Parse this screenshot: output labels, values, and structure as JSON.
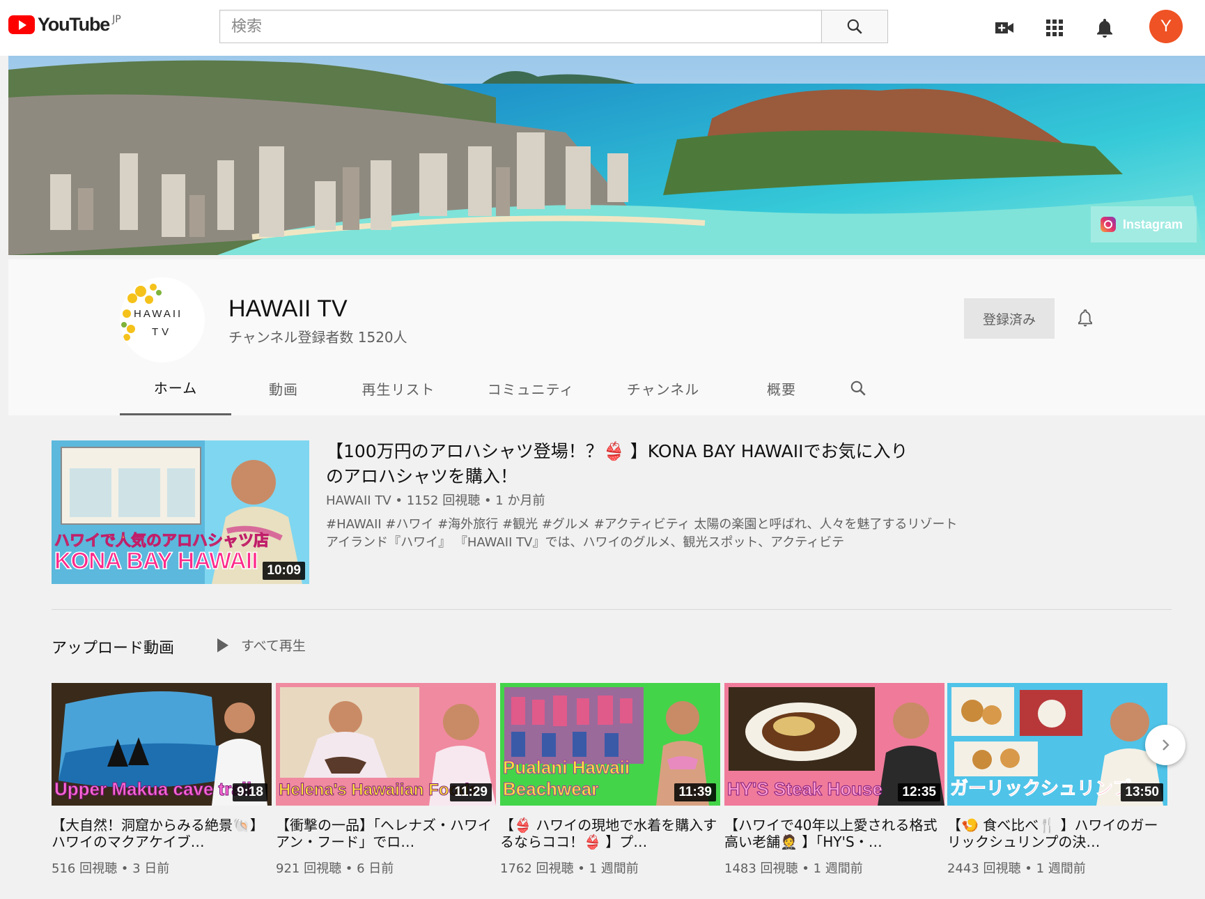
{
  "header": {
    "logo_text": "YouTube",
    "logo_region": "JP",
    "search_placeholder": "検索",
    "avatar_letter": "Y"
  },
  "banner": {
    "link_label": "Instagram"
  },
  "channel": {
    "avatar_line1": "HAWAII",
    "avatar_line2": "TV",
    "name": "HAWAII TV",
    "subscribers": "チャンネル登録者数 1520人",
    "subscribe_label": "登録済み",
    "tabs": [
      {
        "label": "ホーム",
        "active": true
      },
      {
        "label": "動画"
      },
      {
        "label": "再生リスト"
      },
      {
        "label": "コミュニティ"
      },
      {
        "label": "チャンネル"
      },
      {
        "label": "概要"
      }
    ]
  },
  "featured": {
    "title": "【100万円のアロハシャツ登場！？👙 】KONA BAY HAWAIIでお気に入りのアロハシャツを購入！",
    "meta": "HAWAII TV • 1152 回視聴 • 1 か月前",
    "description": "#HAWAII #ハワイ #海外旅行 #観光 #グルメ #アクティビティ 太陽の楽園と呼ばれ、人々を魅了するリゾートアイランド『ハワイ』 『HAWAII TV』では、ハワイのグルメ、観光スポット、アクティビテ",
    "thumb_caption_1": "ハワイで人気のアロハシャツ店",
    "thumb_caption_2": "KONA BAY HAWAII",
    "duration": "10:09"
  },
  "uploads": {
    "section_title": "アップロード動画",
    "play_all": "すべて再生",
    "videos": [
      {
        "title": "【大自然！洞窟からみる絶景🐚】ハワイのマクアケイブ…",
        "meta": "516 回視聴 • 3 日前",
        "duration": "9:18",
        "caption": "Upper Makua cave trail",
        "bg": "#4aa3d8",
        "accent": "#2c6e2c"
      },
      {
        "title": "【衝撃の一品】「ヘレナズ・ハワイアン・フード」でロ…",
        "meta": "921 回視聴 • 6 日前",
        "duration": "11:29",
        "caption": "Helena's Hawaiian Foods",
        "bg": "#f08aa0",
        "accent": "#7a4a2a"
      },
      {
        "title": "【👙 ハワイの現地で水着を購入するならココ！👙 】プ…",
        "meta": "1762 回視聴 • 1 週間前",
        "duration": "11:39",
        "caption": "Pualani Hawaii Beachwear",
        "bg": "#44d44a",
        "accent": "#8a3a8a"
      },
      {
        "title": "【ハワイで40年以上愛される格式高い老舗🤵 】「HY'S・…",
        "meta": "1483 回視聴 • 1 週間前",
        "duration": "12:35",
        "caption": "HY'S Steak House",
        "bg": "#f07a9a",
        "accent": "#6a3a1a"
      },
      {
        "title": "【🍤 食べ比べ🍴 】ハワイのガーリックシュリンプの決…",
        "meta": "2443 回視聴 • 1 週間前",
        "duration": "13:50",
        "caption": "ガーリックシュリンプ",
        "bg": "#4fc3e8",
        "accent": "#c98a3a"
      }
    ]
  }
}
